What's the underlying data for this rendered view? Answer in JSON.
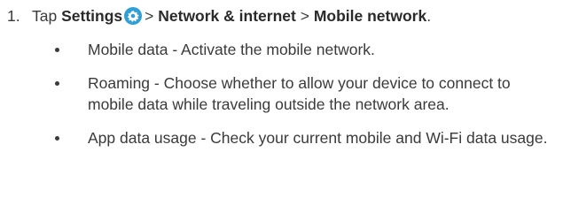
{
  "step": {
    "number": "1.",
    "prefix": "Tap",
    "settings": "Settings",
    "sep1": ">",
    "network": "Network & internet",
    "sep2": ">",
    "mobile": "Mobile network",
    "end": ".",
    "icon": "settings-gear-icon",
    "icon_color": "#2f9fd6"
  },
  "bullets": [
    {
      "text": "Mobile data - Activate the mobile network."
    },
    {
      "text": "Roaming - Choose whether to allow your device to connect to mobile data while traveling outside the network area."
    },
    {
      "text": "App data usage - Check your current mobile and Wi-Fi data usage."
    }
  ]
}
